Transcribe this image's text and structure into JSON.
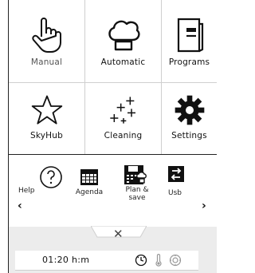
{
  "tiles": [
    {
      "label": "Manual",
      "icon": "hand-pointer-icon"
    },
    {
      "label": "Automatic",
      "icon": "chef-hat-icon"
    },
    {
      "label": "Programs",
      "icon": "book-icon"
    },
    {
      "label": "SkyHub",
      "icon": "star-icon"
    },
    {
      "label": "Cleaning",
      "icon": "sparkles-icon"
    },
    {
      "label": "Settings",
      "icon": "gear-icon"
    }
  ],
  "shortcuts": [
    {
      "label": "Help",
      "icon": "question-icon"
    },
    {
      "label": "Agenda",
      "icon": "calendar-icon"
    },
    {
      "label": "Plan &\nsave",
      "icon": "plan-save-icon"
    },
    {
      "label": "Usb",
      "icon": "usb-transfer-icon"
    }
  ],
  "nav": {
    "prev": "‹",
    "next": "›"
  },
  "bottom": {
    "close_glyph": "✕",
    "time": "01:20 h:m"
  },
  "colors": {
    "border": "#222222",
    "bottom_bg": "#ececec",
    "divider": "#cfcfcf"
  }
}
